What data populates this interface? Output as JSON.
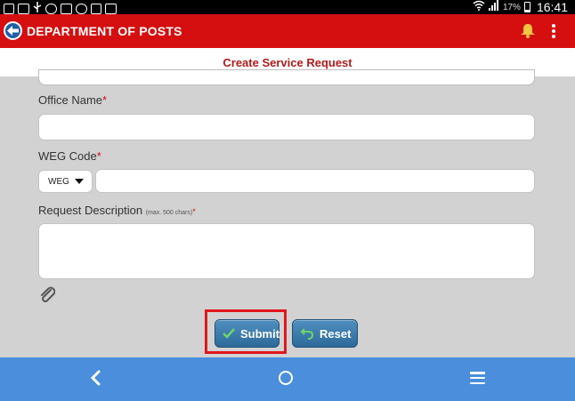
{
  "status_bar": {
    "left_icons": [
      "news-icon",
      "mail-icon",
      "usb-icon",
      "whatsapp-icon",
      "gmail-icon",
      "sync-icon",
      "calendar-icon",
      "gallery-icon"
    ],
    "battery_percent": "17%",
    "time": "16:41"
  },
  "app_bar": {
    "title": "DEPARTMENT OF POSTS",
    "color": "#d50f0f"
  },
  "page": {
    "title": "Create Service Request"
  },
  "form": {
    "office_name_label": "Office Name",
    "office_name_value": "",
    "weg_code_label": "WEG Code",
    "weg_select_value": "WEG",
    "weg_code_value": "",
    "request_description_label": "Request Description",
    "request_description_hint": "(max. 500 chars)",
    "request_description_value": "",
    "required_mark": "*"
  },
  "buttons": {
    "submit_label": "Submit",
    "reset_label": "Reset",
    "accent": "#2d6a99",
    "highlight_color": "#e2161c"
  },
  "nav_bar": {
    "color": "#4a8edc",
    "icons": [
      "back-icon",
      "home-icon",
      "menu-icon"
    ]
  }
}
